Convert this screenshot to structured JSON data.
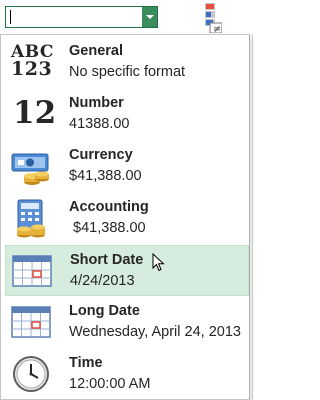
{
  "format_combo": {
    "value": "",
    "drop_icon": "chevron-down-icon"
  },
  "accent_color": "#217346",
  "hover_color": "#d6ecde",
  "formats": [
    {
      "id": "general",
      "name": "General",
      "example": "No specific format",
      "icon": "abc-123-icon",
      "icon_text_top": "ABC",
      "icon_text_bottom": "123"
    },
    {
      "id": "number",
      "name": "Number",
      "example": "41388.00",
      "icon": "number-12-icon",
      "icon_text": "12"
    },
    {
      "id": "currency",
      "name": "Currency",
      "example": "$41,388.00",
      "icon": "currency-icon"
    },
    {
      "id": "accounting",
      "name": "Accounting",
      "example": " $41,388.00",
      "icon": "accounting-icon"
    },
    {
      "id": "short-date",
      "name": "Short Date",
      "example": "4/24/2013",
      "icon": "calendar-icon",
      "hovered": true
    },
    {
      "id": "long-date",
      "name": "Long Date",
      "example": "Wednesday, April 24, 2013",
      "icon": "calendar-icon"
    },
    {
      "id": "time",
      "name": "Time",
      "example": "12:00:00 AM",
      "icon": "clock-icon"
    }
  ]
}
